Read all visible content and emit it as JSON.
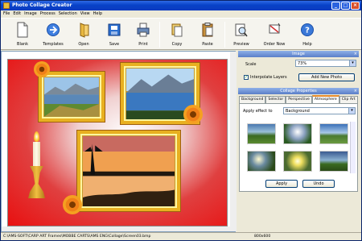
{
  "window": {
    "title": "Photo Collage Creator"
  },
  "menu": [
    "File",
    "Edit",
    "Image",
    "Process",
    "Selection",
    "View",
    "Help"
  ],
  "toolbar": {
    "blank": "Blank",
    "templates": "Templates",
    "open": "Open",
    "save": "Save",
    "print": "Print",
    "copy": "Copy",
    "paste": "Paste",
    "preview": "Preview",
    "order_now": "Order Now",
    "help": "Help"
  },
  "image_panel": {
    "header": "Image",
    "scale_label": "Scale",
    "scale_value": "73%",
    "interpolate_label": "Interpolate Layers",
    "interpolate_checked": true,
    "add_photo_label": "Add New Photo"
  },
  "collage_panel": {
    "header": "Collage Properties",
    "tabs": [
      "Background",
      "Selector",
      "Perspective",
      "Atmosphere",
      "Clip Art"
    ],
    "active_tab": "Atmosphere",
    "apply_effect_label": "Apply effect to",
    "apply_effect_value": "Background",
    "apply_label": "Apply",
    "undo_label": "Undo"
  },
  "status": {
    "path": "C:\\AMS-SOFT\\CARP ART Frames\\MOBBE CARTS\\AMS ENG\\Collage\\Screen03.bmp",
    "size": "800x600"
  },
  "colors": {
    "accent": "#e68b2c",
    "collage_bg": "#e81010",
    "frame": "#e8b020"
  }
}
